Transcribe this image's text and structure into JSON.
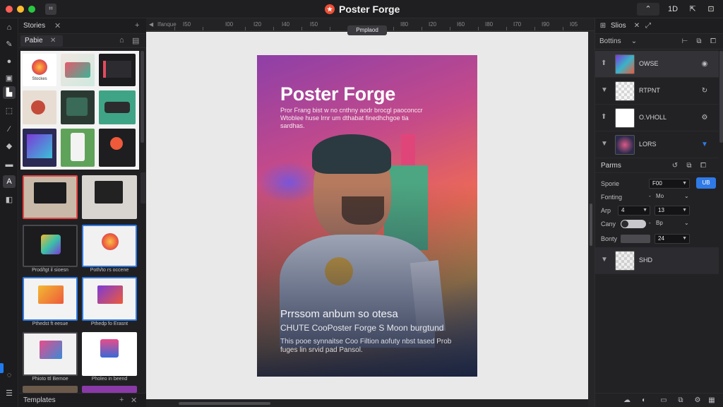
{
  "app": {
    "title": "Poster Forge"
  },
  "titlebar": {
    "zoom_label": "1D"
  },
  "left_panel": {
    "tab_label": "Stories",
    "sub_tab_label": "Pabie",
    "footer_label": "Templates",
    "thumb_captions": [
      "Stockes",
      "Prod/tgt il sioesn",
      "Poth/to rs occene",
      "Pthedst ft eesue",
      "Pthedp fo Erasnt",
      "Phioto ttl Bemoe",
      "Pholeo in beend"
    ]
  },
  "canvas": {
    "ruler_labels": [
      "Ifanque",
      "I50",
      "I00",
      "I20",
      "I40",
      "I50",
      "I80",
      "I20",
      "I60",
      "I80",
      "I70",
      "I90",
      "I05"
    ],
    "tooltip": "Pmplaod"
  },
  "poster": {
    "title": "Poster Forge",
    "lead": "Pror Frang bist w no cnthny aodr brocgl paoconccr Wtoblee huse lrnr um dthabat finedhchgoe tia sardhas.",
    "headline_1": "Prrssom anbum so otesa",
    "headline_2": "CHUTE CooPoster Forge S Moon burgtund",
    "body": "This pooe synnaitse Coo Filtion aofuty nbst tased Prob fuges lin srvid pad Pansol."
  },
  "right_panel": {
    "tab_label": "Slios",
    "section_label": "Bottins",
    "layers": [
      {
        "name": "OWSE"
      },
      {
        "name": "RTPNT"
      },
      {
        "name": "O.VHOLL"
      },
      {
        "name": "LORS"
      },
      {
        "name": "SHD"
      }
    ],
    "properties_label": "Parms",
    "apply_label": "UB",
    "props": [
      {
        "name": "Sporie",
        "value": "F00"
      },
      {
        "name": "Fonting",
        "value": "Mo"
      },
      {
        "name": "Arp",
        "value": "4",
        "value2": "13"
      },
      {
        "name": "Cany",
        "value": "Bp"
      },
      {
        "name": "Bonty",
        "value": "24"
      }
    ]
  }
}
